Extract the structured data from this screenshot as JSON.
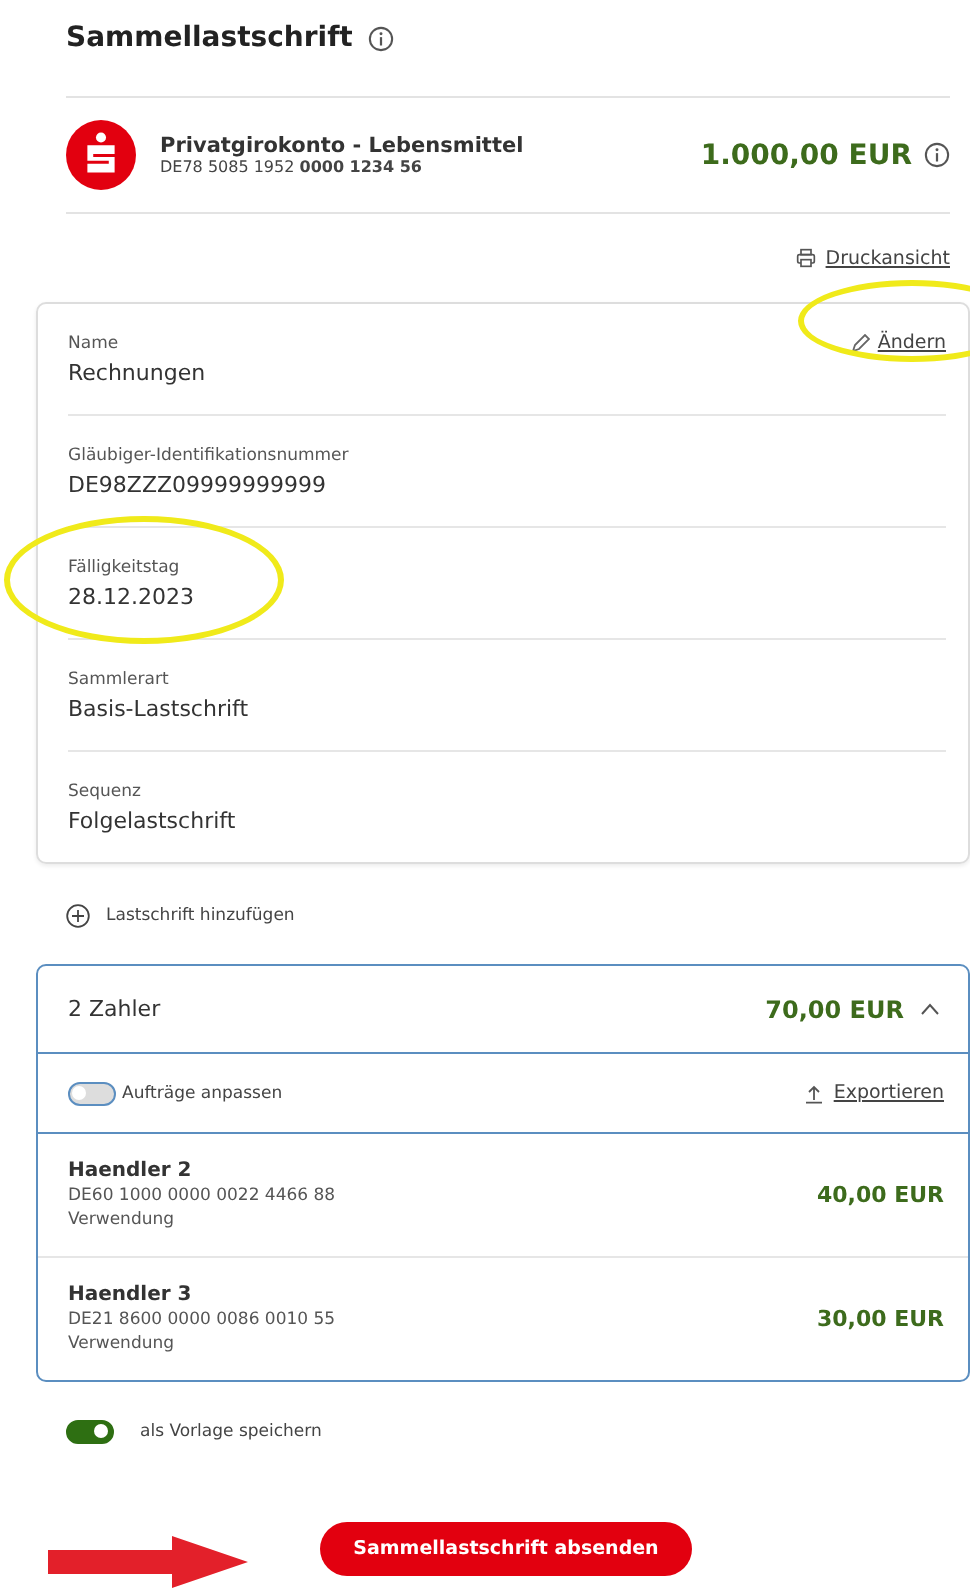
{
  "title": "Sammellastschrift",
  "account": {
    "name": "Privatgirokonto - Lebensmittel",
    "iban_prefix": "DE78 5085 1952 ",
    "iban_suffix": "0000 1234 56",
    "balance": "1.000,00 EUR"
  },
  "print_link": "Druckansicht",
  "details": {
    "edit_link": "Ändern",
    "fields": [
      {
        "label": "Name",
        "value": "Rechnungen",
        "highlighted": false
      },
      {
        "label": "Gläubiger-Identifikationsnummer",
        "value": "DE98ZZZ09999999999",
        "highlighted": false
      },
      {
        "label": "Fälligkeitstag",
        "value": "28.12.2023",
        "highlighted": true
      },
      {
        "label": "Sammlerart",
        "value": "Basis-Lastschrift",
        "highlighted": false
      },
      {
        "label": "Sequenz",
        "value": "Folgelastschrift",
        "highlighted": false
      }
    ]
  },
  "add_link": "Lastschrift hinzufügen",
  "payers": {
    "title": "2 Zahler",
    "total": "70,00 EUR",
    "expanded": true,
    "adjust_toggle": {
      "label": "Aufträge anpassen",
      "on": false
    },
    "export_link": "Exportieren",
    "rows": [
      {
        "name": "Haendler 2",
        "iban": "DE60 1000 0000 0022 4466 88",
        "purpose": "Verwendung",
        "amount": "40,00 EUR"
      },
      {
        "name": "Haendler 3",
        "iban": "DE21 8600 0000 0086 0010 55",
        "purpose": "Verwendung",
        "amount": "30,00 EUR"
      }
    ]
  },
  "template_toggle": {
    "label": "als Vorlage speichern",
    "on": true
  },
  "submit_button": "Sammellastschrift absenden",
  "annotations": {
    "edit_highlighted": true,
    "submit_arrow": true
  }
}
